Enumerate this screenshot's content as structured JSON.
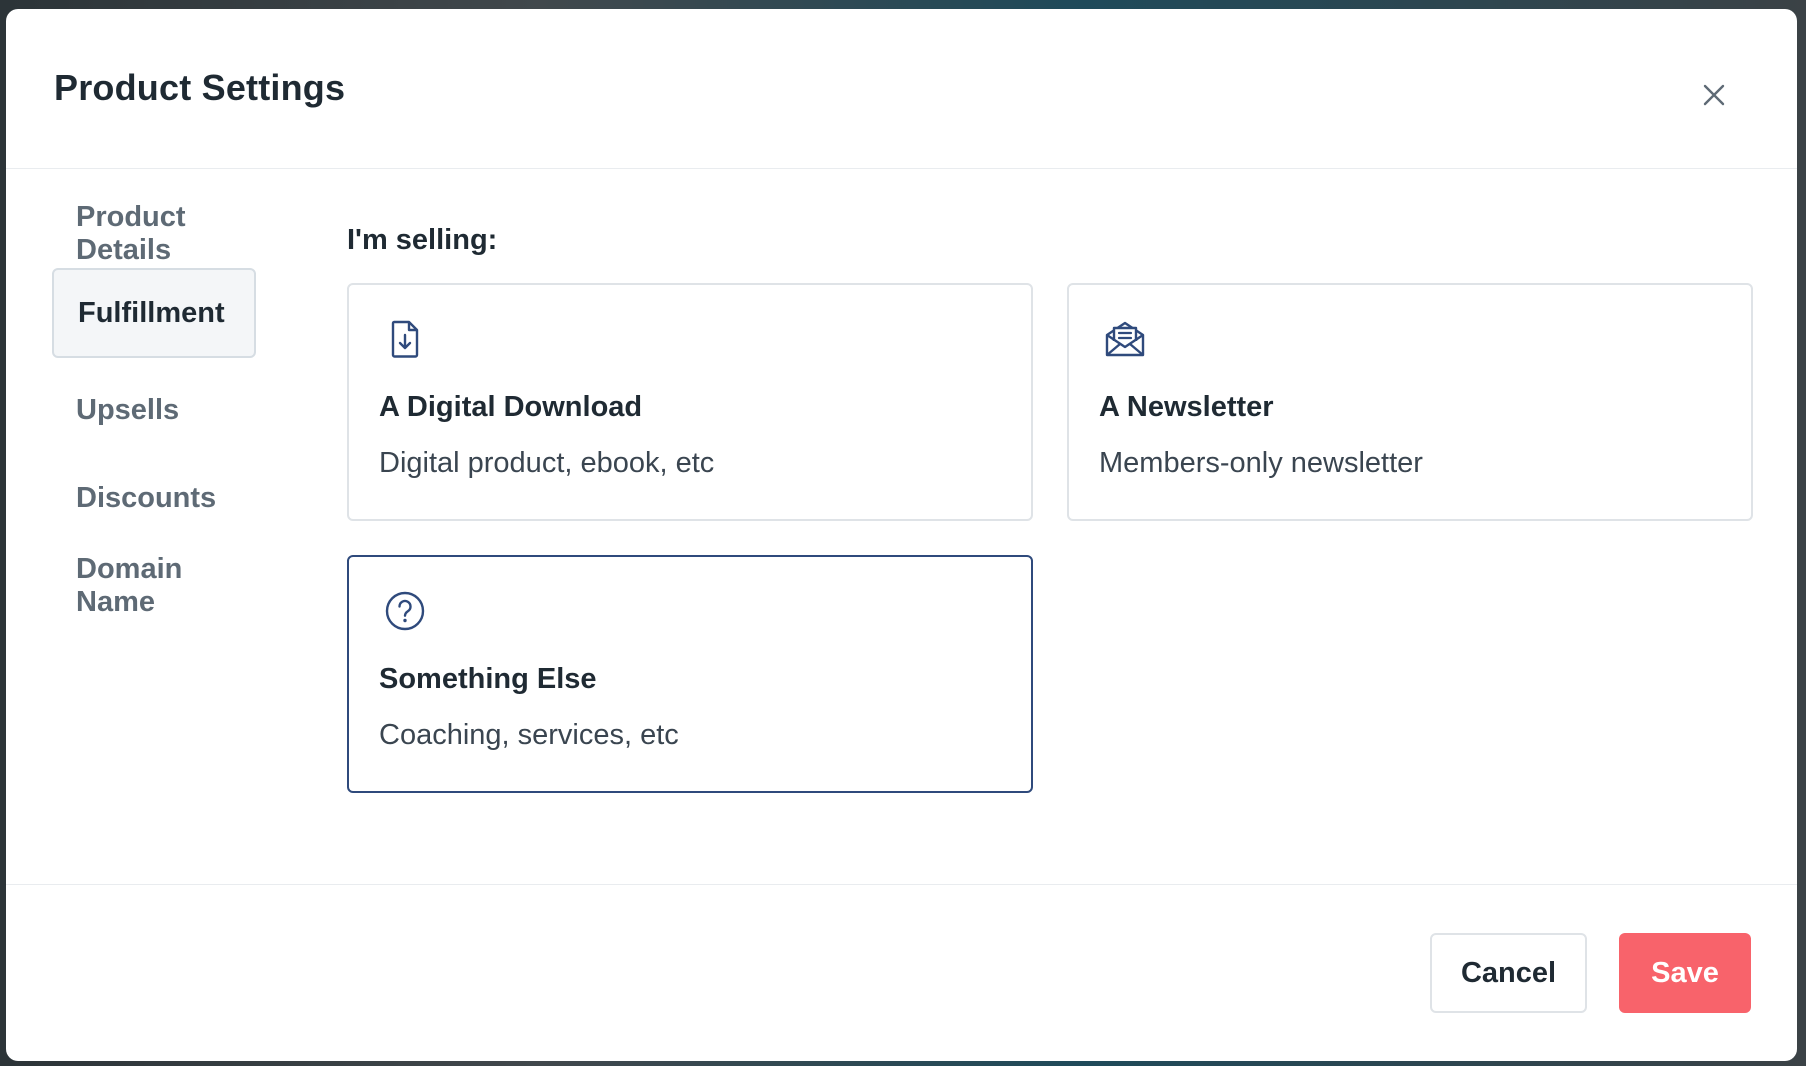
{
  "modal": {
    "title": "Product Settings",
    "close_icon": "close-icon"
  },
  "sidebar": {
    "items": [
      {
        "label": "Product Details",
        "active": false
      },
      {
        "label": "Fulfillment",
        "active": true
      },
      {
        "label": "Upsells",
        "active": false
      },
      {
        "label": "Discounts",
        "active": false
      },
      {
        "label": "Domain Name",
        "active": false
      }
    ]
  },
  "main": {
    "section_label": "I'm selling:",
    "options": [
      {
        "icon": "file-download-icon",
        "title": "A Digital Download",
        "description": "Digital product, ebook, etc",
        "selected": false
      },
      {
        "icon": "envelope-open-icon",
        "title": "A Newsletter",
        "description": "Members-only newsletter",
        "selected": false
      },
      {
        "icon": "question-circle-icon",
        "title": "Something Else",
        "description": "Coaching, services, etc",
        "selected": true
      }
    ]
  },
  "footer": {
    "cancel_label": "Cancel",
    "save_label": "Save"
  },
  "colors": {
    "accent": "#2f4a7c",
    "save_button": "#f8636b",
    "text_primary": "#1f2a33",
    "text_muted": "#5e6a75"
  }
}
